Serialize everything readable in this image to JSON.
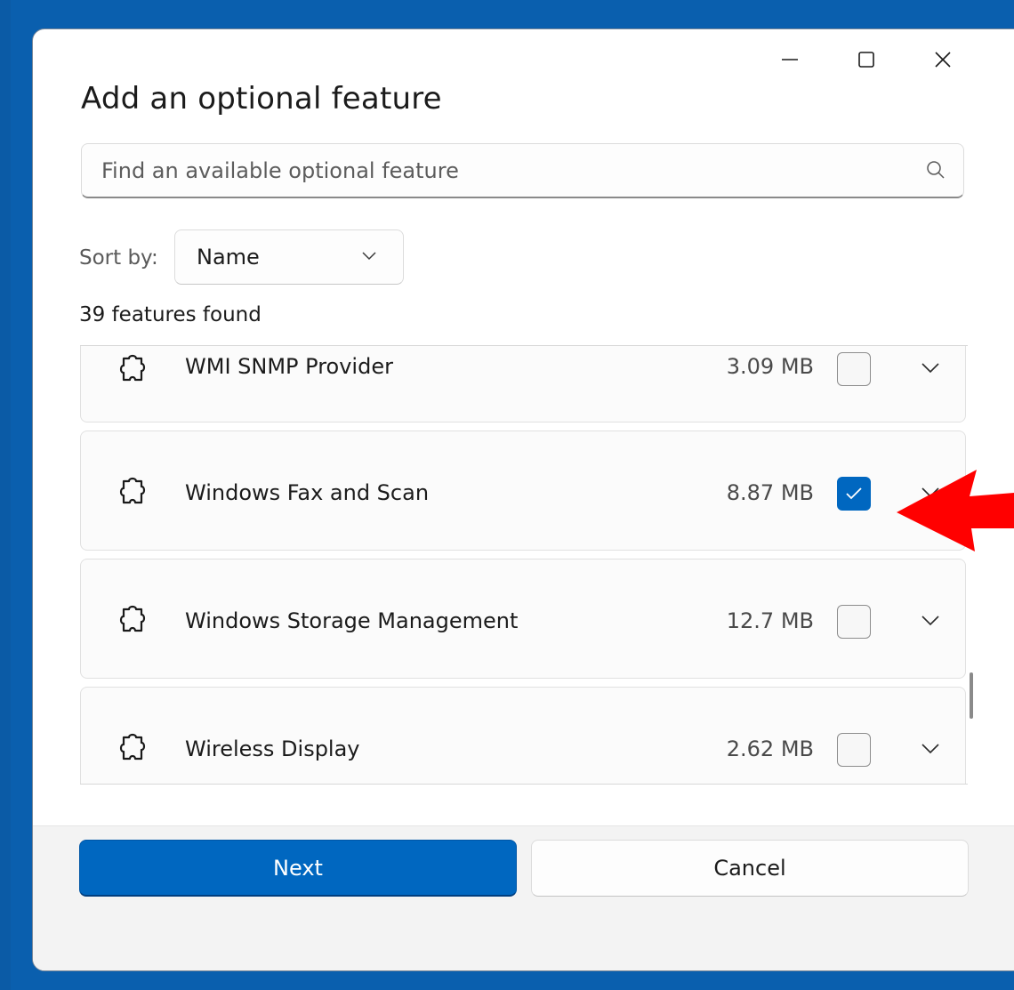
{
  "dialog": {
    "title": "Add an optional feature"
  },
  "window_controls": {
    "minimize_icon": "minimize-icon",
    "maximize_icon": "maximize-icon",
    "close_icon": "close-icon"
  },
  "search": {
    "placeholder": "Find an available optional feature",
    "value": "",
    "icon": "search-icon"
  },
  "sort": {
    "label": "Sort by:",
    "selected": "Name"
  },
  "results": {
    "count_text": "39 features found"
  },
  "features": [
    {
      "name": "WMI SNMP Provider",
      "size": "3.09 MB",
      "checked": false
    },
    {
      "name": "Windows Fax and Scan",
      "size": "8.87 MB",
      "checked": true
    },
    {
      "name": "Windows Storage Management",
      "size": "12.7 MB",
      "checked": false
    },
    {
      "name": "Wireless Display",
      "size": "2.62 MB",
      "checked": false
    }
  ],
  "buttons": {
    "next_label": "Next",
    "cancel_label": "Cancel"
  },
  "annotation": {
    "arrow_color": "#ff0000"
  },
  "colors": {
    "accent": "#0067c0",
    "desktop": "#0a5fae"
  }
}
